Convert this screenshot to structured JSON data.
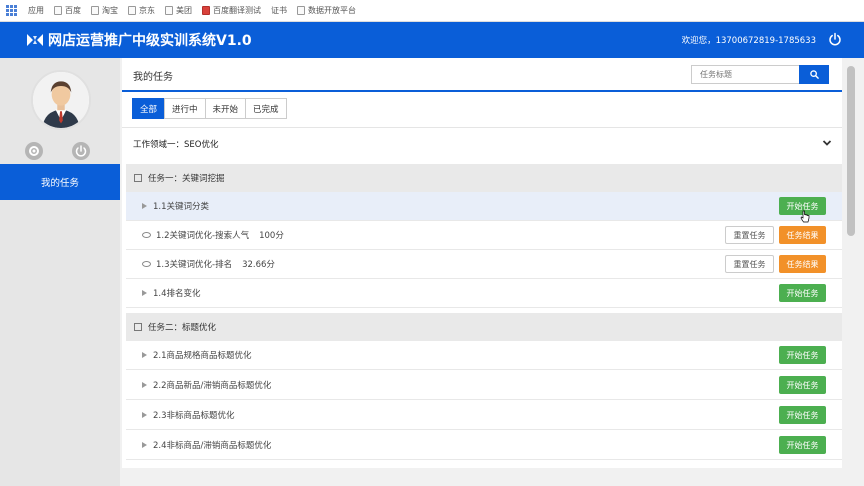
{
  "bookmarks": [
    "应用",
    "百度",
    "淘宝",
    "京东",
    "美团",
    "百度翻译测试",
    "证书",
    "数据开放平台"
  ],
  "app": {
    "title": "网店运营推广中级实训系统V1.0",
    "welcome": "欢迎您，13700672819-1785633",
    "brand_color": "#0a5ed8"
  },
  "sidebar": {
    "nav_item": "我的任务"
  },
  "main": {
    "page_title": "我的任务",
    "search_placeholder": "任务标题",
    "tabs": [
      "全部",
      "进行中",
      "未开始",
      "已完成"
    ],
    "active_tab": "全部",
    "project_label": "工作领域一：SEO优化"
  },
  "tasks": [
    {
      "title": "任务一：关键词挖掘",
      "items": [
        {
          "label": "1.1关键词分类",
          "extra": "",
          "action": "开始任务"
        },
        {
          "label": "1.2关键词优化-搜索人气",
          "extra": "100分",
          "reset": "重置任务",
          "action": "任务结果"
        },
        {
          "label": "1.3关键词优化-排名",
          "extra": "32.66分",
          "reset": "重置任务",
          "action": "任务结果"
        },
        {
          "label": "1.4排名变化",
          "extra": "",
          "action": "开始任务"
        }
      ]
    },
    {
      "title": "任务二：标题优化",
      "items": [
        {
          "label": "2.1商品规格商品标题优化",
          "action": "开始任务"
        },
        {
          "label": "2.2商品新品/滞销商品标题优化",
          "action": "开始任务"
        },
        {
          "label": "2.3非标商品标题优化",
          "action": "开始任务"
        },
        {
          "label": "2.4非标商品/滞销商品标题优化",
          "action": "开始任务"
        }
      ]
    }
  ]
}
